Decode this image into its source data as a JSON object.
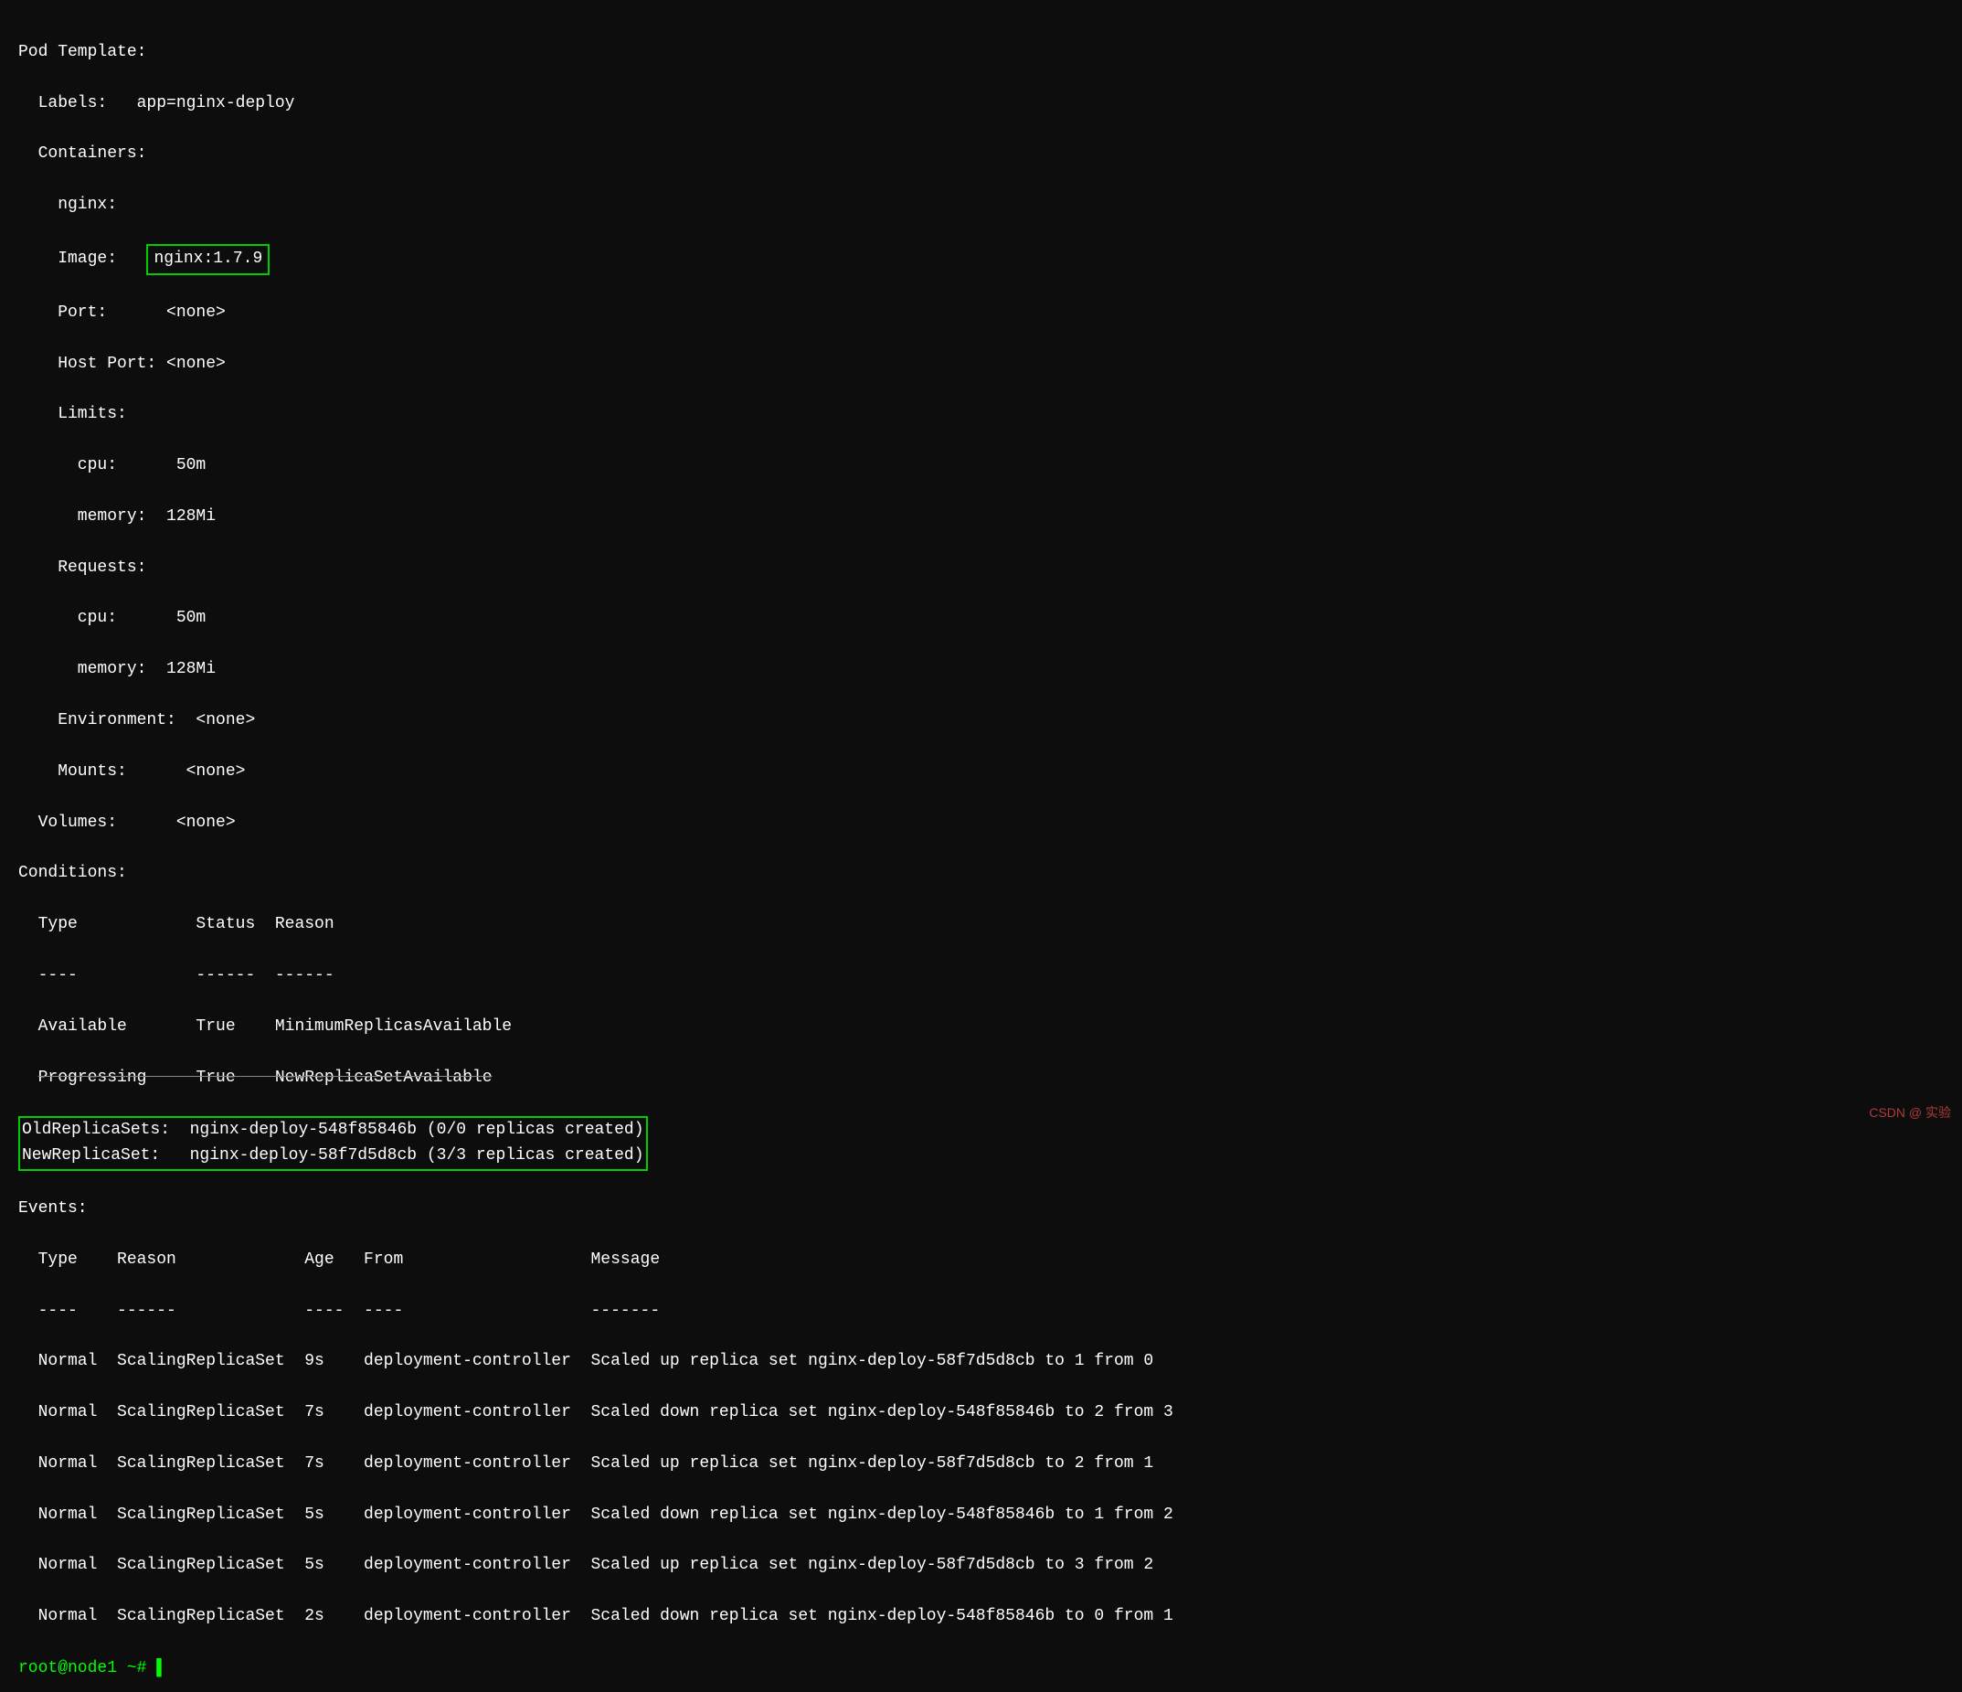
{
  "terminal": {
    "lines": [
      {
        "id": "pod-template",
        "text": "Pod Template:"
      },
      {
        "id": "labels",
        "text": "  Labels:   app=nginx-deploy"
      },
      {
        "id": "containers",
        "text": "  Containers:"
      },
      {
        "id": "nginx",
        "text": "    nginx:"
      },
      {
        "id": "image-label",
        "text": "    Image:   ",
        "image_value": "nginx:1.7.9"
      },
      {
        "id": "port",
        "text": "    Port:      <none>"
      },
      {
        "id": "host-port",
        "text": "    Host Port: <none>"
      },
      {
        "id": "limits",
        "text": "    Limits:"
      },
      {
        "id": "cpu",
        "text": "      cpu:      50m"
      },
      {
        "id": "memory",
        "text": "      memory:  128Mi"
      },
      {
        "id": "requests",
        "text": "    Requests:"
      },
      {
        "id": "req-cpu",
        "text": "      cpu:      50m"
      },
      {
        "id": "req-memory",
        "text": "      memory:  128Mi"
      },
      {
        "id": "environment",
        "text": "    Environment:  <none>"
      },
      {
        "id": "mounts",
        "text": "    Mounts:      <none>"
      },
      {
        "id": "volumes",
        "text": "  Volumes:      <none>"
      },
      {
        "id": "conditions",
        "text": "Conditions:"
      },
      {
        "id": "cond-header",
        "text": "  Type            Status  Reason"
      },
      {
        "id": "cond-sep",
        "text": "  ----            ------  ------"
      },
      {
        "id": "available",
        "text": "  Available       True    MinimumReplicasAvailable"
      },
      {
        "id": "progressing",
        "text": "  Progressing     True    NewReplicaSetAvailable",
        "strikethrough": true
      },
      {
        "id": "old-replica",
        "text": "OldReplicaSets:  nginx-deploy-548f85846b (0/0 replicas created)"
      },
      {
        "id": "new-replica",
        "text": "NewReplicaSet:   nginx-deploy-58f7d5d8cb (3/3 replicas created)"
      },
      {
        "id": "events",
        "text": "Events:"
      },
      {
        "id": "ev-header",
        "text": "  Type    Reason             Age   From                   Message"
      },
      {
        "id": "ev-sep",
        "text": "  ----    ------             ----  ----                   -------"
      },
      {
        "id": "ev1",
        "type": "Normal",
        "reason": "ScalingReplicaSet",
        "age": "9s",
        "from": "deployment-controller",
        "message": "Scaled up replica set nginx-deploy-58f7d5d8cb to 1 from 0"
      },
      {
        "id": "ev2",
        "type": "Normal",
        "reason": "ScalingReplicaSet",
        "age": "7s",
        "from": "deployment-controller",
        "message": "Scaled down replica set nginx-deploy-548f85846b to 2 from 3"
      },
      {
        "id": "ev3",
        "type": "Normal",
        "reason": "ScalingReplicaSet",
        "age": "7s",
        "from": "deployment-controller",
        "message": "Scaled up replica set nginx-deploy-58f7d5d8cb to 2 from 1"
      },
      {
        "id": "ev4",
        "type": "Normal",
        "reason": "ScalingReplicaSet",
        "age": "5s",
        "from": "deployment-controller",
        "message": "Scaled down replica set nginx-deploy-548f85846b to 1 from 2"
      },
      {
        "id": "ev5",
        "type": "Normal",
        "reason": "ScalingReplicaSet",
        "age": "5s",
        "from": "deployment-controller",
        "message": "Scaled up replica set nginx-deploy-58f7d5d8cb to 3 from 2"
      },
      {
        "id": "ev6",
        "type": "Normal",
        "reason": "ScalingReplicaSet",
        "age": "2s",
        "from": "deployment-controller",
        "message": "Scaled down replica set nginx-deploy-548f85846b to 0 from 1"
      }
    ],
    "prompt": "root@node1",
    "prompt_suffix": " ~#"
  }
}
